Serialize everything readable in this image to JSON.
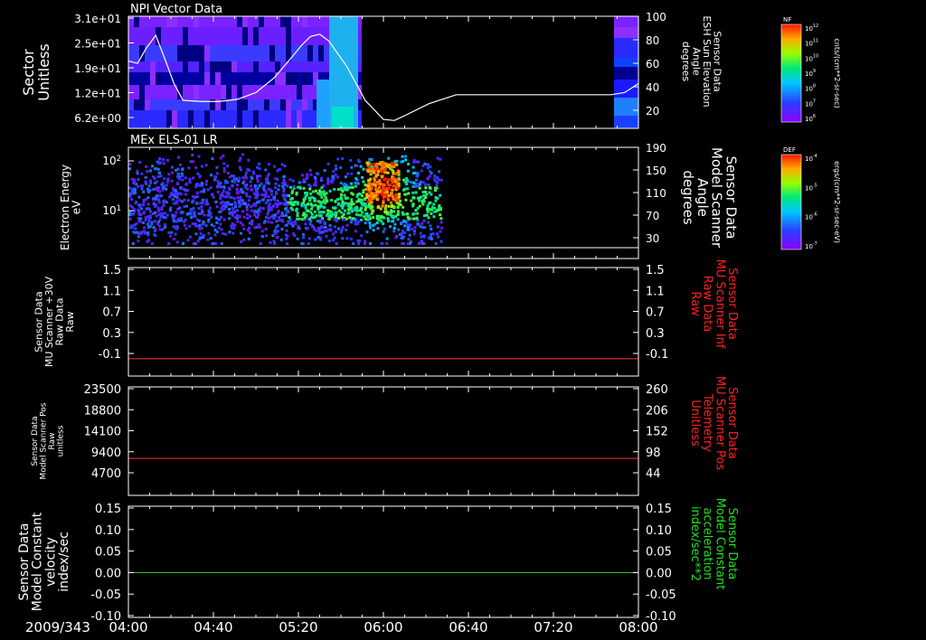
{
  "date_label": "2009/343",
  "time_ticks": [
    "04:00",
    "04:40",
    "05:20",
    "06:00",
    "06:40",
    "07:20",
    "08:00"
  ],
  "chart_data": [
    {
      "type": "heatmap",
      "title": "NPI Vector Data",
      "ylabel": [
        "Sector",
        "Unitless"
      ],
      "y_ticks": [
        "3.1e+01",
        "2.5e+01",
        "1.9e+01",
        "1.2e+01",
        "6.2e+00"
      ],
      "right_ylabel": [
        "Sensor Data",
        "ESH Sun Elevation",
        "Angle",
        "degrees"
      ],
      "right_ticks": [
        "100",
        "80",
        "60",
        "40",
        "20"
      ],
      "right_range": [
        0,
        100
      ],
      "overlay_line": {
        "color": "#ffffff",
        "points": [
          [
            0,
            60
          ],
          [
            10,
            58
          ],
          [
            20,
            72
          ],
          [
            30,
            83
          ],
          [
            40,
            62
          ],
          [
            50,
            40
          ],
          [
            60,
            25
          ],
          [
            80,
            24
          ],
          [
            100,
            24
          ],
          [
            120,
            26
          ],
          [
            140,
            32
          ],
          [
            160,
            45
          ],
          [
            180,
            64
          ],
          [
            190,
            74
          ],
          [
            200,
            82
          ],
          [
            210,
            84
          ],
          [
            220,
            78
          ],
          [
            240,
            55
          ],
          [
            260,
            25
          ],
          [
            280,
            8
          ],
          [
            292,
            7
          ],
          [
            305,
            12
          ],
          [
            330,
            22
          ],
          [
            360,
            30
          ],
          [
            400,
            30
          ],
          [
            450,
            30
          ],
          [
            500,
            30
          ],
          [
            530,
            30
          ],
          [
            545,
            32
          ],
          [
            560,
            40
          ]
        ]
      },
      "colorbar": {
        "label": "NF",
        "unit": "cnts/(cm**2-sr-sec)",
        "ticks": [
          "10^12",
          "10^11",
          "10^10",
          "10^9",
          "10^8",
          "10^7",
          "10^6"
        ]
      }
    },
    {
      "type": "heatmap",
      "title": "MEx ELS-01 LR",
      "ylabel": [
        "Electron Energy",
        "eV"
      ],
      "y_ticks": [
        "10^2",
        "10^1"
      ],
      "right_ylabel": [
        "Sensor Data",
        "Model Scanner",
        "Angle",
        "degrees"
      ],
      "right_ticks": [
        "190",
        "150",
        "110",
        "70",
        "30"
      ],
      "right_range": [
        0,
        190
      ],
      "overlay_line": {
        "color": "#ffffff",
        "constant": 0
      },
      "colorbar": {
        "label": "DEF",
        "unit": "ergs/(cm**2-sr-sec-eV)",
        "ticks": [
          "10^-4",
          "10^-5",
          "10^-6",
          "10^-7"
        ]
      }
    },
    {
      "type": "line",
      "ylabel": [
        "Sensor Data",
        "MU Scanner +30V",
        "Raw Data",
        "Raw"
      ],
      "y_ticks": [
        "1.5",
        "1.1",
        "0.7",
        "0.3",
        "-0.1"
      ],
      "ylim": [
        -0.3,
        1.5
      ],
      "series": [
        {
          "color": "#ff3030",
          "constant": -0.2
        }
      ],
      "right_ylabel": [
        "Sensor Data",
        "MU Scanner Inf",
        "Raw Data",
        "Raw"
      ],
      "right_ticks": [
        "1.5",
        "1.1",
        "0.7",
        "0.3",
        "-0.1"
      ],
      "right_color": "#ff2020"
    },
    {
      "type": "line",
      "ylabel": [
        "Sensor Data",
        "Model Scanner Pos",
        "Raw",
        "unitless"
      ],
      "y_ticks": [
        "23500",
        "18800",
        "14100",
        "9400",
        "4700"
      ],
      "ylim": [
        0,
        23500
      ],
      "series": [
        {
          "color": "#ff3030",
          "constant": 7900
        }
      ],
      "right_ylabel": [
        "Sensor Data",
        "MU Scanner Pos",
        "Telemetry",
        "Unitless"
      ],
      "right_ticks": [
        "260",
        "206",
        "152",
        "98",
        "44"
      ],
      "right_color": "#ff2020"
    },
    {
      "type": "line",
      "ylabel": [
        "Sensor Data",
        "Model Constant",
        "velocity",
        "index/sec"
      ],
      "y_ticks": [
        "0.15",
        "0.10",
        "0.05",
        "0.00",
        "-0.05",
        "-0.10"
      ],
      "ylim": [
        -0.1,
        0.15
      ],
      "series": [
        {
          "color": "#20e020",
          "constant": 0.0
        }
      ],
      "right_ylabel": [
        "Sensor Data",
        "Model Constant",
        "acceleration",
        "index/sec**2"
      ],
      "right_ticks": [
        "0.15",
        "0.10",
        "0.05",
        "0.00",
        "-0.05",
        "-0.10"
      ],
      "right_color": "#20e020"
    }
  ]
}
